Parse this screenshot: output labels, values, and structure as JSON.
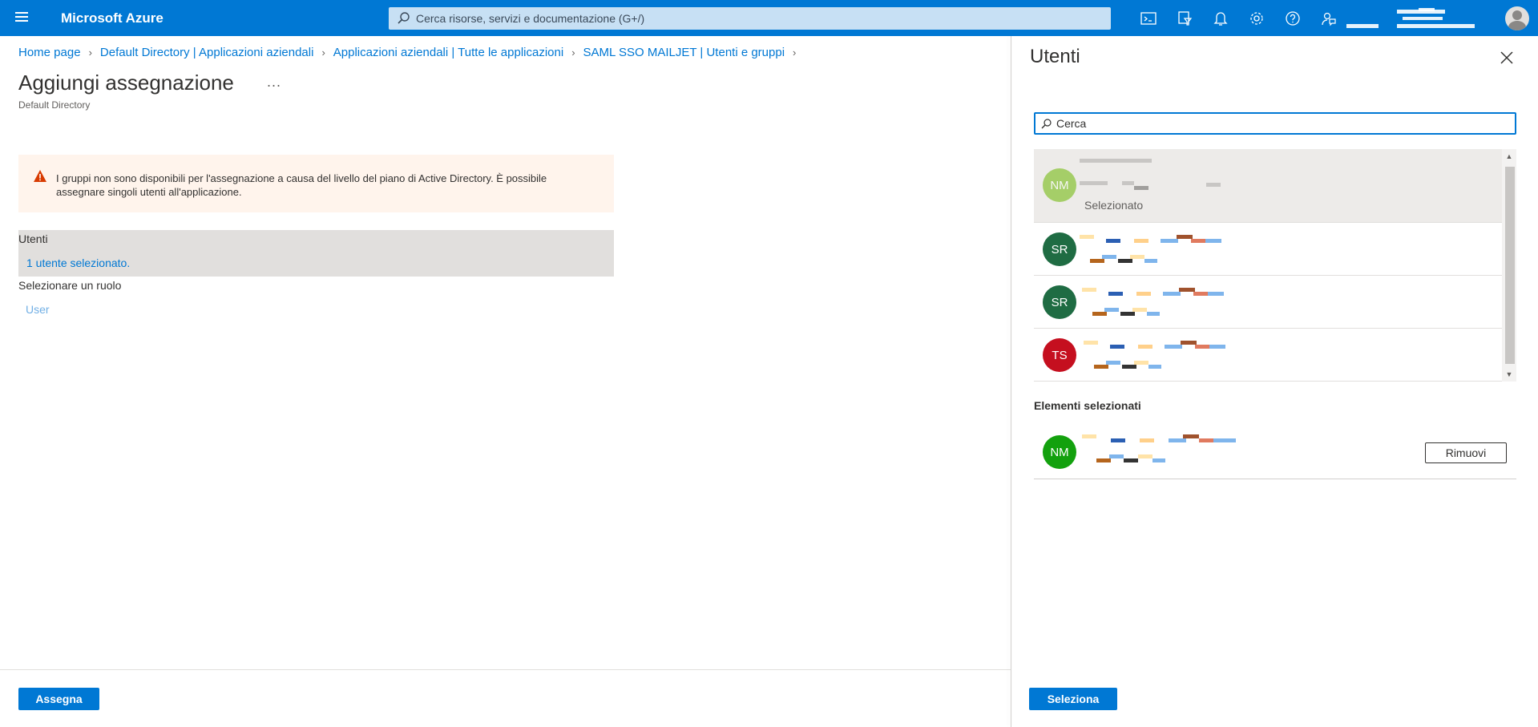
{
  "app": {
    "brand": "Microsoft Azure"
  },
  "search": {
    "placeholder": "Cerca risorse, servizi e documentazione (G+/)"
  },
  "topbar_icons": [
    "cloud-shell-icon",
    "directory-filter-icon",
    "notifications-icon",
    "settings-icon",
    "help-icon",
    "feedback-icon"
  ],
  "breadcrumb": [
    "Home page",
    "Default Directory | Applicazioni aziendali",
    "Applicazioni aziendali | Tutte le applicazioni",
    "SAML SSO MAILJET | Utenti e gruppi"
  ],
  "page": {
    "title": "Aggiungi assegnazione",
    "more": "...",
    "subtitle": "Default Directory"
  },
  "warning": {
    "text": "I gruppi non sono disponibili per l'assegnazione a causa del livello del piano di Active Directory. È possibile assegnare singoli utenti all'applicazione."
  },
  "users_section": {
    "label": "Utenti",
    "selected_text": "1 utente selezionato."
  },
  "role_section": {
    "label": "Selezionare un ruolo",
    "value": "User"
  },
  "footer": {
    "assign_label": "Assegna"
  },
  "panel": {
    "title": "Utenti",
    "search_placeholder": "Cerca",
    "users": [
      {
        "initials": "NM",
        "color": "#6bb700",
        "selected": true,
        "selected_label": "Selezionato"
      },
      {
        "initials": "SR",
        "color": "#1f6c43",
        "selected": false
      },
      {
        "initials": "SR",
        "color": "#1f6c43",
        "selected": false
      },
      {
        "initials": "TS",
        "color": "#c50f1f",
        "selected": false
      }
    ],
    "selected_heading": "Elementi selezionati",
    "selected_items": [
      {
        "initials": "NM",
        "color": "#13a10e"
      }
    ],
    "remove_label": "Rimuovi",
    "select_label": "Seleziona"
  }
}
